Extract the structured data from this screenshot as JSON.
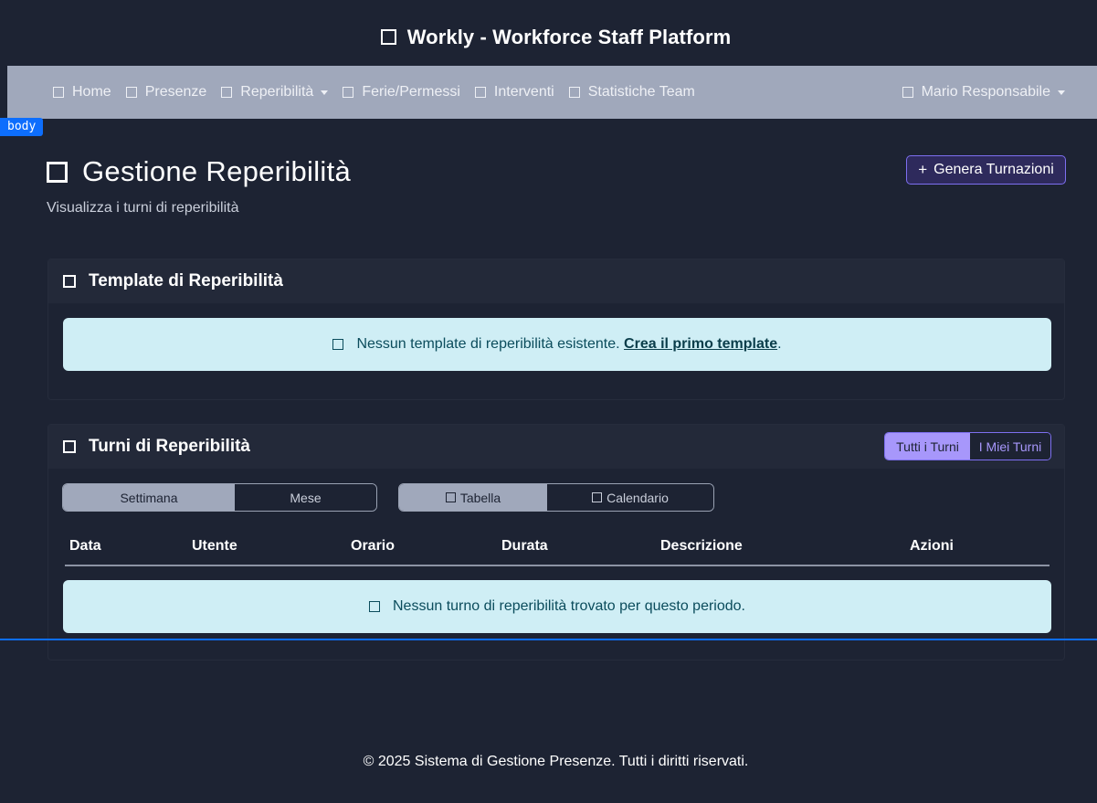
{
  "app": {
    "title": "Workly - Workforce Staff Platform"
  },
  "nav": {
    "items": [
      {
        "label": "Home"
      },
      {
        "label": "Presenze"
      },
      {
        "label": "Reperibilità"
      },
      {
        "label": "Ferie/Permessi"
      },
      {
        "label": "Interventi"
      },
      {
        "label": "Statistiche Team"
      }
    ],
    "user": "Mario Responsabile"
  },
  "debug_tag": "body",
  "page": {
    "title": "Gestione Reperibilità",
    "subtitle": "Visualizza i turni di reperibilità",
    "generate_button": "Genera Turnazioni",
    "generate_plus": "+"
  },
  "templates_card": {
    "title": "Template di Reperibilità",
    "alert_text": "Nessun template di reperibilità esistente.",
    "alert_link": "Crea il primo template",
    "alert_end": "."
  },
  "shifts_card": {
    "title": "Turni di Reperibilità",
    "filter_all": "Tutti i Turni",
    "filter_mine": "I Miei Turni",
    "period_week": "Settimana",
    "period_month": "Mese",
    "view_table": "Tabella",
    "view_calendar": "Calendario",
    "columns": [
      "Data",
      "Utente",
      "Orario",
      "Durata",
      "Descrizione",
      "Azioni"
    ],
    "empty_text": "Nessun turno di reperibilità trovato per questo periodo."
  },
  "footer": {
    "text": "© 2025 Sistema di Gestione Presenze. Tutti i diritti riservati."
  },
  "colors": {
    "background": "#1d2333",
    "navbar": "#a0a8bb",
    "accent": "#a797fb",
    "info_alert": "#cfeef5",
    "debug_blue": "#0d6efd"
  }
}
